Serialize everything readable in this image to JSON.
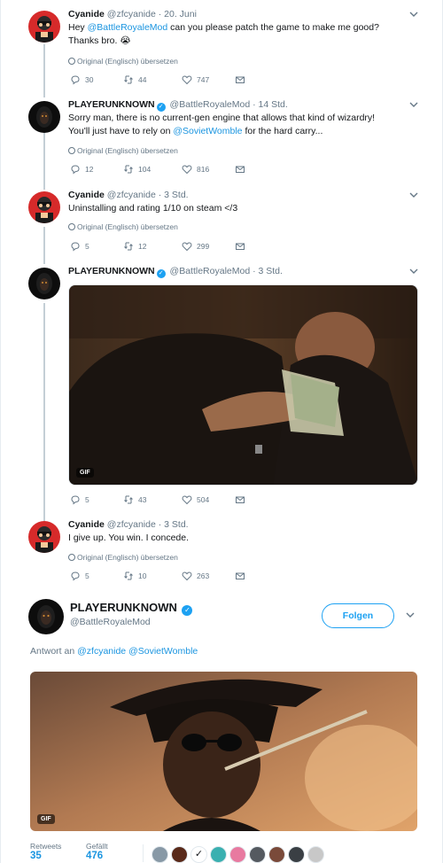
{
  "tweets": [
    {
      "name": "Cyanide",
      "handle": "@zfcyanide",
      "time": "· 20. Juni",
      "text_pre": "Hey ",
      "mention1": "@BattleRoyaleMod",
      "text_post": " can you please patch the game to make me good?",
      "text_line2": "Thanks bro. 😭",
      "translate": "Original (Englisch) übersetzen",
      "replies": "30",
      "retweets": "44",
      "likes": "747"
    },
    {
      "name": "PLAYERUNKNOWN",
      "handle": "@BattleRoyaleMod",
      "time": "· 14 Std.",
      "text_line1": "Sorry man, there is no current-gen engine that allows that kind of wizardry!",
      "text_pre2": "You'll just have to rely on ",
      "mention1": "@SovietWomble",
      "text_post2": " for the hard carry...",
      "translate": "Original (Englisch) übersetzen",
      "replies": "12",
      "retweets": "104",
      "likes": "816"
    },
    {
      "name": "Cyanide",
      "handle": "@zfcyanide",
      "time": "· 3 Std.",
      "text": "Uninstalling and rating 1/10 on steam </3",
      "translate": "Original (Englisch) übersetzen",
      "replies": "5",
      "retweets": "12",
      "likes": "299"
    },
    {
      "name": "PLAYERUNKNOWN",
      "handle": "@BattleRoyaleMod",
      "time": "· 3 Std.",
      "gif_label": "GIF",
      "replies": "5",
      "retweets": "43",
      "likes": "504"
    },
    {
      "name": "Cyanide",
      "handle": "@zfcyanide",
      "time": "· 3 Std.",
      "text": "I give up. You win. I concede.",
      "translate": "Original (Englisch) übersetzen",
      "replies": "5",
      "retweets": "10",
      "likes": "263"
    }
  ],
  "main": {
    "name": "PLAYERUNKNOWN",
    "handle": "@BattleRoyaleMod",
    "follow_label": "Folgen",
    "reply_prefix": "Antwort an ",
    "reply_mention1": "@zfcyanide",
    "reply_mention2": "@SovietWomble",
    "gif_label": "GIF",
    "retweets_label": "Retweets",
    "retweets_count": "35",
    "likes_label": "Gefällt",
    "likes_count": "476"
  },
  "colors": {
    "accent": "#1da1f2",
    "link": "#1b95e0",
    "muted": "#657786",
    "thread_line": "#c4cfd6"
  }
}
